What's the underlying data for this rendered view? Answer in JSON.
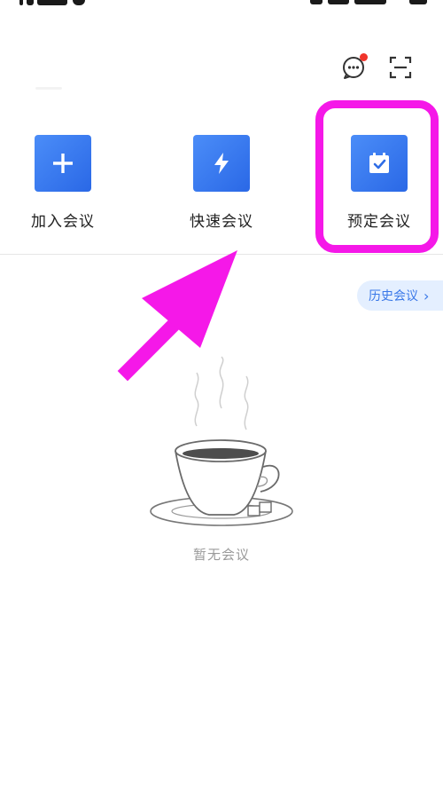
{
  "header": {
    "chat_icon": "chat-bubble-icon",
    "scan_icon": "scan-icon",
    "has_notification": true
  },
  "actions": [
    {
      "label": "加入会议",
      "icon": "plus-icon"
    },
    {
      "label": "快速会议",
      "icon": "lightning-icon"
    },
    {
      "label": "预定会议",
      "icon": "calendar-check-icon"
    }
  ],
  "history": {
    "label": "历史会议",
    "icon": "chevron-right-icon"
  },
  "empty_state": {
    "text": "暂无会议",
    "illustration": "coffee-cup-illustration"
  },
  "annotation": {
    "color": "#f518e8"
  },
  "colors": {
    "accent": "#2f72ec",
    "tile": "#3a7af0",
    "notification": "#f0342b"
  }
}
